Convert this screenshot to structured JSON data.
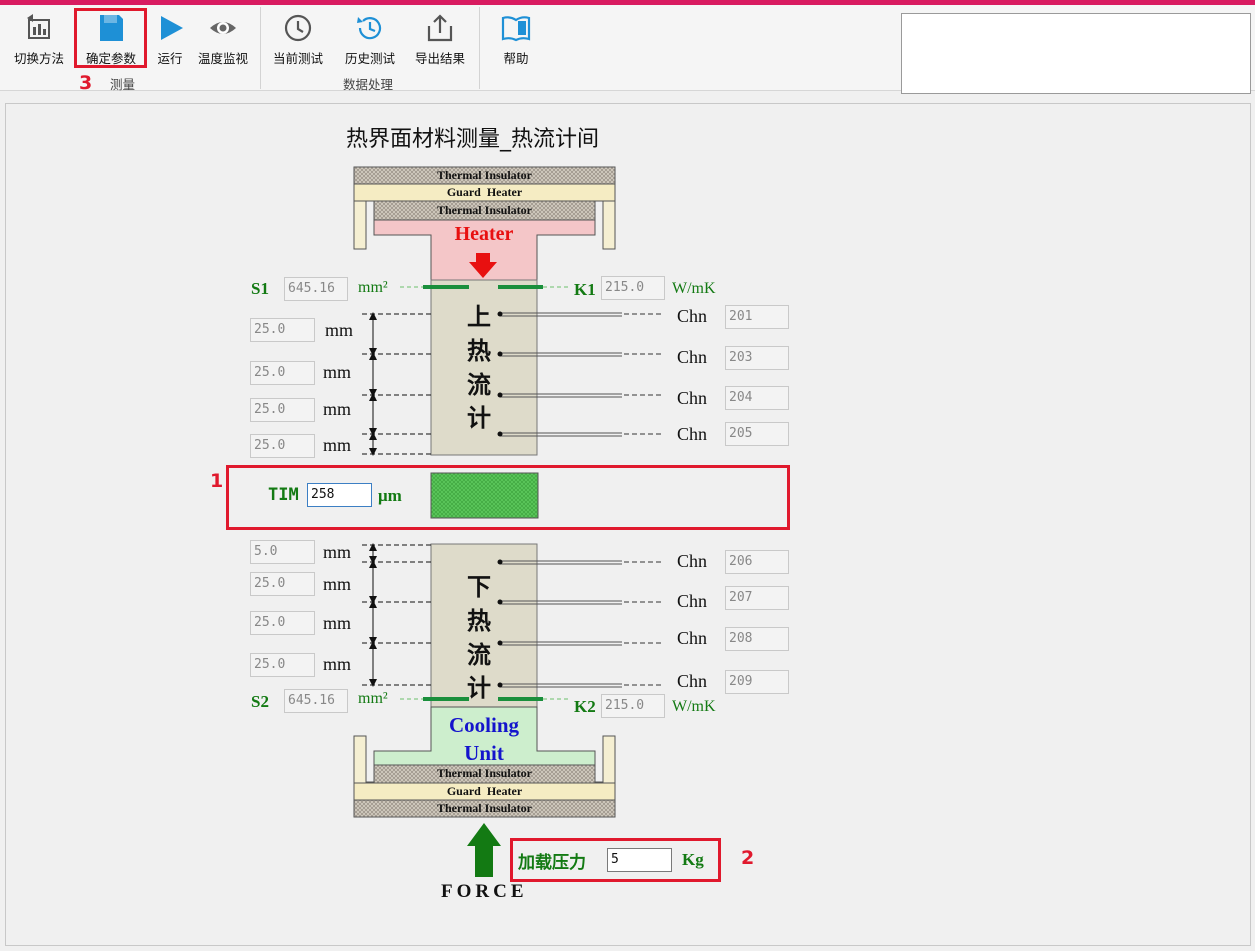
{
  "toolbar": {
    "buttons": [
      {
        "label": "切换方法",
        "icon": "switch-method-icon"
      },
      {
        "label": "确定参数",
        "icon": "save-parameters-icon"
      },
      {
        "label": "运行",
        "icon": "run-play-icon"
      },
      {
        "label": "温度监视",
        "icon": "eye-monitor-icon"
      },
      {
        "label": "当前测试",
        "icon": "clock-icon"
      },
      {
        "label": "历史测试",
        "icon": "history-icon"
      },
      {
        "label": "导出结果",
        "icon": "export-icon"
      },
      {
        "label": "帮助",
        "icon": "book-help-icon"
      }
    ],
    "groups": {
      "measure": "测量",
      "data": "数据处理"
    }
  },
  "annotations": {
    "a1": "1",
    "a2": "2",
    "a3": "3"
  },
  "diagram": {
    "title": "热界面材料测量_热流计间",
    "top": {
      "insulator_top": "Thermal Insulator",
      "guard": "Guard  Heater",
      "insulator_inner": "Thermal Insulator",
      "heater": "Heater"
    },
    "bottom": {
      "cooling1": "Cooling",
      "cooling2": "Unit",
      "insulator_inner": "Thermal Insulator",
      "guard": "Guard  Heater",
      "insulator_bottom": "Thermal Insulator"
    },
    "upper_meter_chars": [
      "上",
      "热",
      "流",
      "计"
    ],
    "lower_meter_chars": [
      "下",
      "热",
      "流",
      "计"
    ],
    "s1": {
      "label": "S1",
      "value": "645.16",
      "unit": "mm²"
    },
    "k1": {
      "label": "K1",
      "value": "215.0",
      "unit": "W/mK"
    },
    "s2": {
      "label": "S2",
      "value": "645.16",
      "unit": "mm²"
    },
    "k2": {
      "label": "K2",
      "value": "215.0",
      "unit": "W/mK"
    },
    "upper_distances": [
      "25.0",
      "25.0",
      "25.0",
      "25.0"
    ],
    "lower_distances": [
      "5.0",
      "25.0",
      "25.0",
      "25.0"
    ],
    "mm": "mm",
    "chn": "Chn",
    "upper_channels": [
      "201",
      "203",
      "204",
      "205"
    ],
    "lower_channels": [
      "206",
      "207",
      "208",
      "209"
    ],
    "tim": {
      "label": "TIM",
      "value": "258",
      "unit": "μm"
    },
    "pressure": {
      "label": "加载压力",
      "value": "5",
      "unit": "Kg"
    },
    "force": "FORCE"
  },
  "colors": {
    "accent_bar": "#d81b60",
    "highlight": "#e0192d",
    "label_green": "#137a13",
    "heater": "#f4c6c8",
    "cooling": "#cdeecd",
    "tim": "#59c659"
  }
}
